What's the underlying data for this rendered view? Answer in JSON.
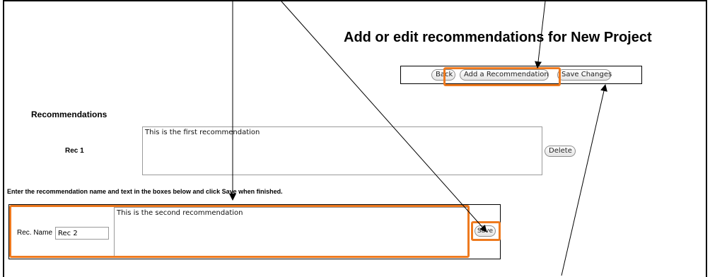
{
  "page": {
    "title": "Add or edit recommendations for New Project"
  },
  "toolbar": {
    "back_label": "Back",
    "add_label": "Add a Recommendation",
    "save_label": "Save Changes"
  },
  "recommendations": {
    "section_title": "Recommendations",
    "items": [
      {
        "label": "Rec 1",
        "text": "This is the first recommendation",
        "delete_label": "Delete"
      }
    ]
  },
  "new_recommendation": {
    "instruction": "Enter the recommendation name and text in the boxes below and click Save when finished.",
    "name_label": "Rec. Name",
    "name_value": "Rec 2",
    "text_value": "This is the second recommendation",
    "save_label": "Save"
  },
  "colors": {
    "highlight": "#ee7a1f",
    "arrow": "#000000"
  }
}
